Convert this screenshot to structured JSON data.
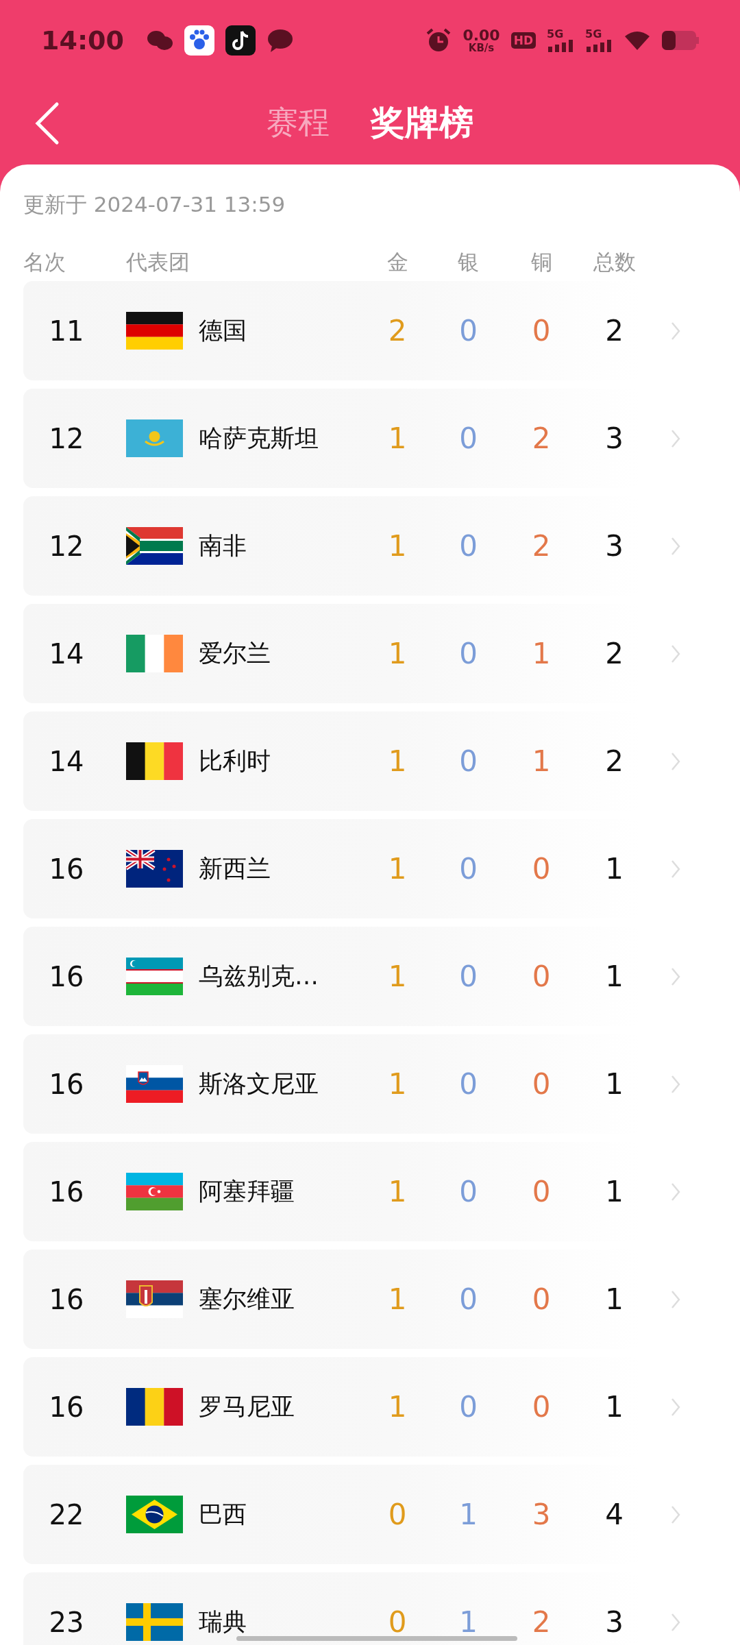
{
  "status_bar": {
    "time": "14:00",
    "net_speed": "0.00",
    "net_unit": "KB/s",
    "hd": "HD",
    "sim_labels": [
      "5G",
      "5G"
    ]
  },
  "header": {
    "tabs": [
      {
        "label": "赛程",
        "selected": false
      },
      {
        "label": "奖牌榜",
        "selected": true
      }
    ]
  },
  "updated": "更新于 2024-07-31 13:59",
  "columns": [
    "名次",
    "代表团",
    "金",
    "银",
    "铜",
    "总数"
  ],
  "rows": [
    {
      "rank": "11",
      "flag": {
        "kind": "germany"
      },
      "name": "德国",
      "gold": "2",
      "silver": "0",
      "bronze": "0",
      "total": "2"
    },
    {
      "rank": "12",
      "flag": {
        "kind": "kazakhstan"
      },
      "name": "哈萨克斯坦",
      "gold": "1",
      "silver": "0",
      "bronze": "2",
      "total": "3"
    },
    {
      "rank": "12",
      "flag": {
        "kind": "southafrica"
      },
      "name": "南非",
      "gold": "1",
      "silver": "0",
      "bronze": "2",
      "total": "3"
    },
    {
      "rank": "14",
      "flag": {
        "kind": "ireland"
      },
      "name": "爱尔兰",
      "gold": "1",
      "silver": "0",
      "bronze": "1",
      "total": "2"
    },
    {
      "rank": "14",
      "flag": {
        "kind": "belgium"
      },
      "name": "比利时",
      "gold": "1",
      "silver": "0",
      "bronze": "1",
      "total": "2"
    },
    {
      "rank": "16",
      "flag": {
        "kind": "newzealand"
      },
      "name": "新西兰",
      "gold": "1",
      "silver": "0",
      "bronze": "0",
      "total": "1"
    },
    {
      "rank": "16",
      "flag": {
        "kind": "uzbekistan"
      },
      "name": "乌兹别克…",
      "gold": "1",
      "silver": "0",
      "bronze": "0",
      "total": "1"
    },
    {
      "rank": "16",
      "flag": {
        "kind": "slovenia"
      },
      "name": "斯洛文尼亚",
      "gold": "1",
      "silver": "0",
      "bronze": "0",
      "total": "1"
    },
    {
      "rank": "16",
      "flag": {
        "kind": "azerbaijan"
      },
      "name": "阿塞拜疆",
      "gold": "1",
      "silver": "0",
      "bronze": "0",
      "total": "1"
    },
    {
      "rank": "16",
      "flag": {
        "kind": "serbia"
      },
      "name": "塞尔维亚",
      "gold": "1",
      "silver": "0",
      "bronze": "0",
      "total": "1"
    },
    {
      "rank": "16",
      "flag": {
        "kind": "romania"
      },
      "name": "罗马尼亚",
      "gold": "1",
      "silver": "0",
      "bronze": "0",
      "total": "1"
    },
    {
      "rank": "22",
      "flag": {
        "kind": "brazil"
      },
      "name": "巴西",
      "gold": "0",
      "silver": "1",
      "bronze": "3",
      "total": "4"
    },
    {
      "rank": "23",
      "flag": {
        "kind": "sweden"
      },
      "name": "瑞典",
      "gold": "0",
      "silver": "1",
      "bronze": "2",
      "total": "3"
    }
  ]
}
